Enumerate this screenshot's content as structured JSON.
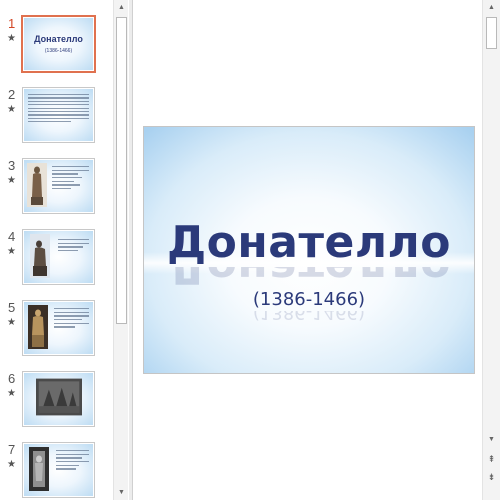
{
  "presentation": {
    "title_slide": {
      "title": "Донателло",
      "subtitle": "(1386-1466)"
    }
  },
  "thumbnails": [
    {
      "number": "1",
      "star": "★",
      "active": true,
      "kind": "title"
    },
    {
      "number": "2",
      "star": "★",
      "active": false,
      "kind": "text"
    },
    {
      "number": "3",
      "star": "★",
      "active": false,
      "kind": "photo-text"
    },
    {
      "number": "4",
      "star": "★",
      "active": false,
      "kind": "photo-text"
    },
    {
      "number": "5",
      "star": "★",
      "active": false,
      "kind": "photo-text"
    },
    {
      "number": "6",
      "star": "★",
      "active": false,
      "kind": "photo-wide"
    },
    {
      "number": "7",
      "star": "★",
      "active": false,
      "kind": "photo-text"
    }
  ],
  "icons": {
    "scroll_up": "▲",
    "scroll_down": "▼",
    "prev_slide": "⇞",
    "next_slide": "⇟"
  },
  "colors": {
    "accent_selection": "#e0714f",
    "slide_number_active": "#d24726",
    "title_text": "#2b3a7a",
    "slide_bg_edge": "#a9d1f0"
  }
}
